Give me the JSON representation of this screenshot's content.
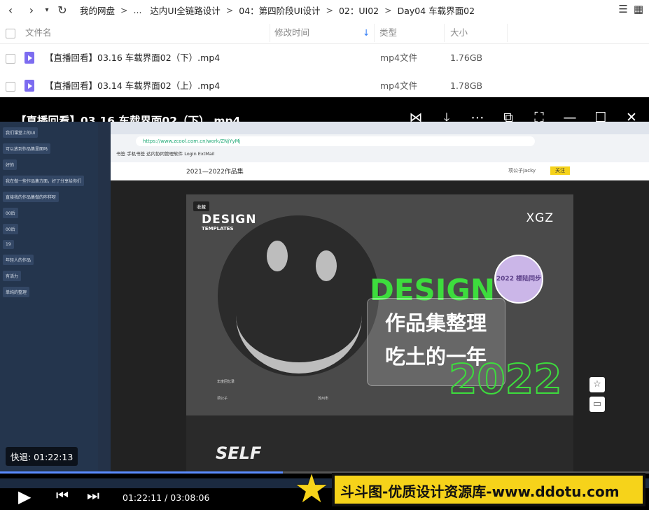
{
  "nav": {
    "breadcrumbs": [
      "我的网盘",
      "...",
      "达内UI全链路设计",
      "04：第四阶段UI设计",
      "02：UI02",
      "Day04 车载界面02"
    ],
    "separator": ">"
  },
  "table": {
    "headers": {
      "name": "文件名",
      "modified": "修改时间",
      "type": "类型",
      "size": "大小"
    },
    "rows": [
      {
        "name": "【直播回看】03.16 车载界面02（下）.mp4",
        "type": "mp4文件",
        "size": "1.76GB"
      },
      {
        "name": "【直播回看】03.14 车载界面02（上）.mp4",
        "type": "mp4文件",
        "size": "1.78GB"
      }
    ]
  },
  "player": {
    "title": "【直播回看】03.16 车载界面02（下）.mp4",
    "rewind_label": "快退: 01:22:13",
    "time": "01:22:11 / 03:08:06",
    "progress": 0.436,
    "accent": "#5b8cff"
  },
  "video": {
    "url": "https://www.zcool.com.cn/work/ZNjYyMj",
    "page_title": "2021—2022作品集",
    "user": "项公子jacky",
    "follow": "关注",
    "collect": "收藏",
    "design": "DESIGN",
    "templates": "TEMPLATES",
    "xgz": "XGZ",
    "green_word": "DESIGN",
    "line1": "作品集整理",
    "line2": "吃土的一年",
    "year": "2022",
    "seal": "2022 楼陆同步",
    "self": "SELF",
    "bookmarks": "书签   手机书签   达内协同管理软件   Login ExtMail",
    "mini1": "年度回忆录",
    "mini2": "项公子",
    "mini3": "苏州市",
    "chat": [
      "我们课堂上的UI",
      "可以放到作品集里面吗",
      "好的",
      "我在做一些作品集方面，好了分享给你们",
      "直接我的作品集做的咋样呀",
      "00后",
      "00后",
      "19",
      "年轻人的作品",
      "有活力",
      "单纯的整理"
    ]
  },
  "banner": {
    "text": "斗斗图-优质设计资源库-www.ddotu.com"
  }
}
